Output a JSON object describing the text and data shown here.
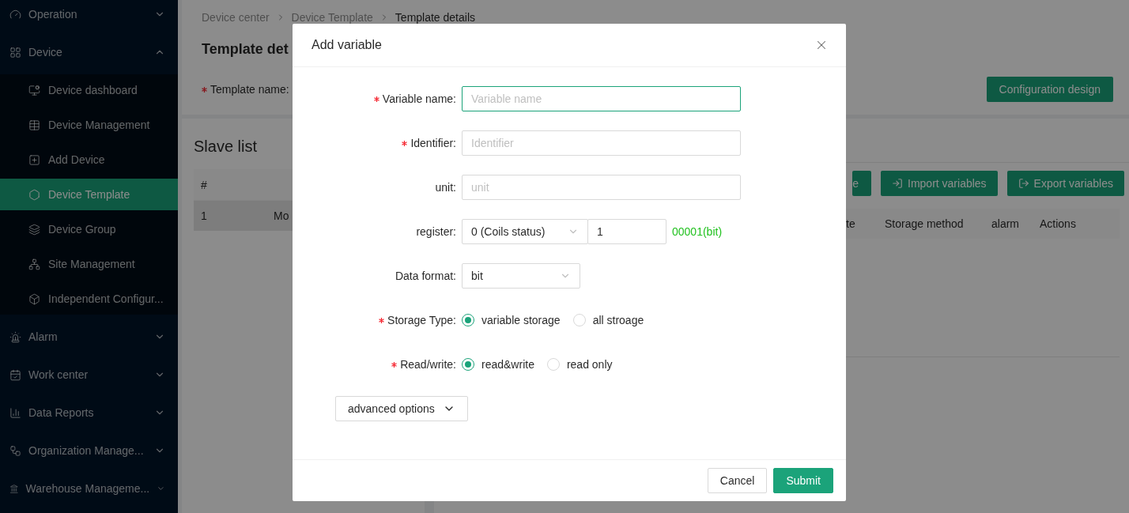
{
  "sidebar": {
    "items": [
      {
        "label": "Operation",
        "expanded": false
      },
      {
        "label": "Device",
        "expanded": true,
        "children": [
          {
            "label": "Device dashboard",
            "selected": false
          },
          {
            "label": "Device Management",
            "selected": false
          },
          {
            "label": "Add Device",
            "selected": false
          },
          {
            "label": "Device Template",
            "selected": true
          },
          {
            "label": "Device Group",
            "selected": false
          },
          {
            "label": "Site Management",
            "selected": false
          },
          {
            "label": "Independent Configur...",
            "selected": false
          }
        ]
      },
      {
        "label": "Alarm",
        "expanded": false
      },
      {
        "label": "Work center",
        "expanded": false
      },
      {
        "label": "Data Reports",
        "expanded": false
      },
      {
        "label": "Organization Manage...",
        "expanded": false
      },
      {
        "label": "Warehouse Manageme...",
        "expanded": false
      }
    ]
  },
  "breadcrumb": [
    {
      "label": "Device center",
      "current": false
    },
    {
      "label": "Device Template",
      "current": false
    },
    {
      "label": "Template details",
      "current": true
    }
  ],
  "page": {
    "title": "Template det",
    "template_name_label": "Template name:",
    "template_name_required": true,
    "config_button": "Configuration design"
  },
  "slave_list": {
    "title": "Slave list",
    "columns": [
      "#"
    ],
    "rows": [
      {
        "cells": [
          "1",
          "Mo"
        ],
        "selected": true
      }
    ]
  },
  "variables": {
    "buttons": [
      {
        "label": "e",
        "kind": "partial"
      },
      {
        "label": "Import variables",
        "kind": "import"
      },
      {
        "label": "Export variables",
        "kind": "export"
      }
    ],
    "columns": [
      "te",
      "Storage method",
      "alarm",
      "Actions"
    ]
  },
  "modal": {
    "title": "Add variable",
    "fields": [
      {
        "kind": "input",
        "label": "Variable name:",
        "required": true,
        "placeholder": "Variable name",
        "focused": true
      },
      {
        "kind": "input",
        "label": "Identifier:",
        "required": true,
        "placeholder": "Identifier",
        "focused": false
      },
      {
        "kind": "input",
        "label": "unit:",
        "required": false,
        "placeholder": "unit",
        "focused": false
      },
      {
        "kind": "register",
        "label": "register:",
        "required": false,
        "select_value": "0 (Coils status)",
        "value": "1",
        "hint": "00001(bit)"
      },
      {
        "kind": "select",
        "label": "Data format:",
        "required": false,
        "value": "bit"
      },
      {
        "kind": "radio",
        "label": "Storage Type:",
        "required": true,
        "options": [
          {
            "label": "variable storage",
            "selected": true
          },
          {
            "label": "all stroage",
            "selected": false
          }
        ]
      },
      {
        "kind": "radio",
        "label": "Read/write:",
        "required": true,
        "options": [
          {
            "label": "read&write",
            "selected": true
          },
          {
            "label": "read only",
            "selected": false
          }
        ]
      }
    ],
    "advanced_button": "advanced options",
    "buttons": [
      {
        "label": "Cancel",
        "kind": "default"
      },
      {
        "label": "Submit",
        "kind": "primary"
      }
    ]
  }
}
